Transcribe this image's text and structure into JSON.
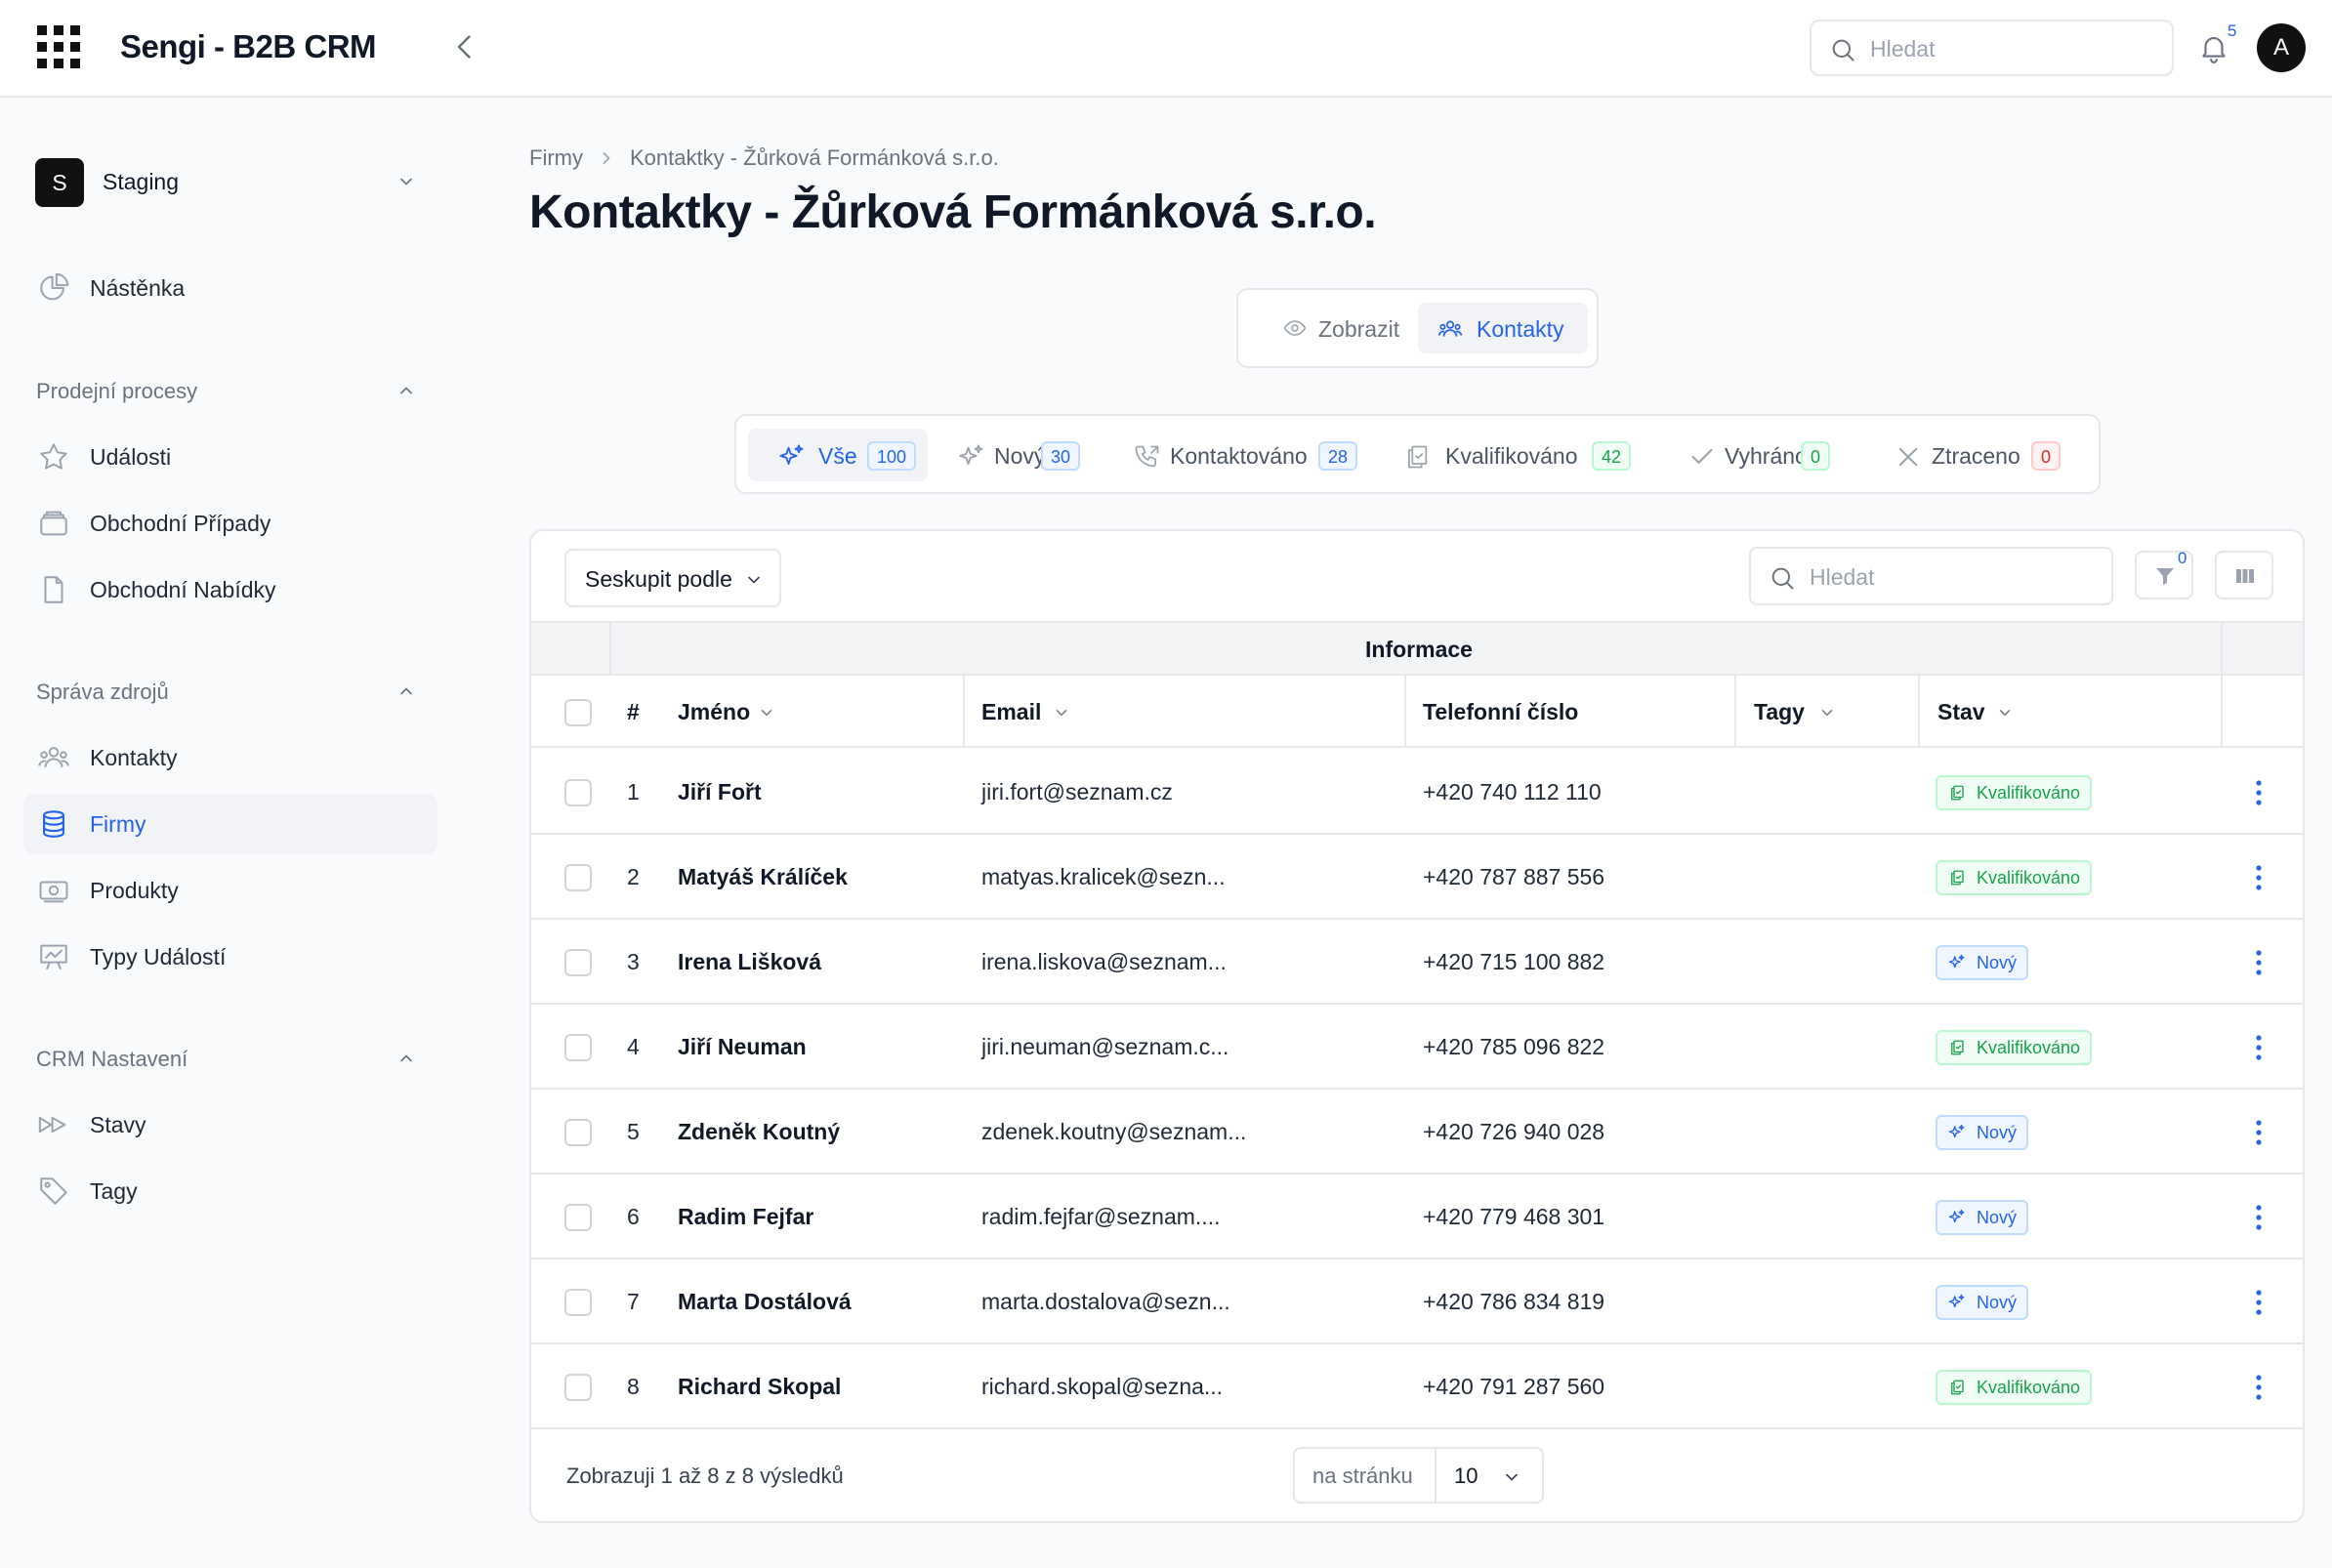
{
  "app": {
    "title": "Sengi - B2B CRM"
  },
  "topbar": {
    "search_placeholder": "Hledat",
    "notifications_count": "5",
    "avatar_initial": "A"
  },
  "sidebar": {
    "workspace": {
      "initial": "S",
      "name": "Staging"
    },
    "dashboard": "Nástěnka",
    "sections": [
      {
        "title": "Prodejní procesy",
        "items": [
          "Události",
          "Obchodní Případy",
          "Obchodní Nabídky"
        ]
      },
      {
        "title": "Správa zdrojů",
        "items": [
          "Kontakty",
          "Firmy",
          "Produkty",
          "Typy Událostí"
        ]
      },
      {
        "title": "CRM Nastavení",
        "items": [
          "Stavy",
          "Tagy"
        ]
      }
    ],
    "active_item": "Firmy"
  },
  "breadcrumb": [
    "Firmy",
    "Kontaktky - Žůrková Formánková s.r.o."
  ],
  "page_title": "Kontaktky - Žůrková Formánková s.r.o.",
  "view_switch": {
    "show": "Zobrazit",
    "contacts": "Kontakty",
    "active": "Kontakty"
  },
  "status_tabs": [
    {
      "label": "Vše",
      "count": "100",
      "active": true
    },
    {
      "label": "Nový",
      "count": "30"
    },
    {
      "label": "Kontaktováno",
      "count": "28"
    },
    {
      "label": "Kvalifikováno",
      "count": "42"
    },
    {
      "label": "Vyhráno",
      "count": "0"
    },
    {
      "label": "Ztraceno",
      "count": "0"
    }
  ],
  "toolbar": {
    "group_by": "Seskupit podle",
    "search_placeholder": "Hledat",
    "filter_count": "0"
  },
  "table": {
    "group_header": "Informace",
    "columns": [
      "#",
      "Jméno",
      "Email",
      "Telefonní číslo",
      "Tagy",
      "Stav"
    ],
    "rows": [
      {
        "num": "1",
        "name": "Jiří Fořt",
        "email": "jiri.fort@seznam.cz",
        "phone": "+420 740 112 110",
        "status": "Kvalifikováno"
      },
      {
        "num": "2",
        "name": "Matyáš Králíček",
        "email": "matyas.kralicek@sezn...",
        "phone": "+420 787 887 556",
        "status": "Kvalifikováno"
      },
      {
        "num": "3",
        "name": "Irena Lišková",
        "email": "irena.liskova@seznam...",
        "phone": "+420 715 100 882",
        "status": "Nový"
      },
      {
        "num": "4",
        "name": "Jiří Neuman",
        "email": "jiri.neuman@seznam.c...",
        "phone": "+420 785 096 822",
        "status": "Kvalifikováno"
      },
      {
        "num": "5",
        "name": "Zdeněk Koutný",
        "email": "zdenek.koutny@seznam...",
        "phone": "+420 726 940 028",
        "status": "Nový"
      },
      {
        "num": "6",
        "name": "Radim Fejfar",
        "email": "radim.fejfar@seznam....",
        "phone": "+420 779 468 301",
        "status": "Nový"
      },
      {
        "num": "7",
        "name": "Marta Dostálová",
        "email": "marta.dostalova@sezn...",
        "phone": "+420 786 834 819",
        "status": "Nový"
      },
      {
        "num": "8",
        "name": "Richard Skopal",
        "email": "richard.skopal@sezna...",
        "phone": "+420 791 287 560",
        "status": "Kvalifikováno"
      }
    ]
  },
  "footer": {
    "summary": "Zobrazuji 1 až 8 z 8 výsledků",
    "per_page_label": "na stránku",
    "per_page_value": "10"
  },
  "colors": {
    "accent": "#2563eb",
    "success": "#16a34a",
    "danger": "#dc2626",
    "text": "#111827",
    "muted": "#6b7280",
    "border": "#e5e7eb"
  }
}
